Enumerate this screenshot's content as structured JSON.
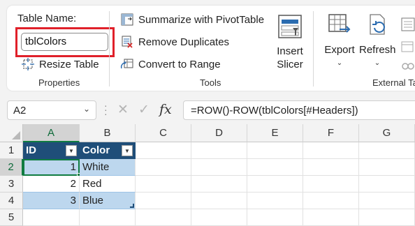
{
  "ribbon": {
    "properties": {
      "table_name_label": "Table Name:",
      "table_name_value": "tblColors",
      "resize_label": "Resize Table",
      "group_label": "Properties"
    },
    "tools": {
      "pivot_label": "Summarize with PivotTable",
      "dupes_label": "Remove Duplicates",
      "convert_label": "Convert to Range",
      "slicer_line1": "Insert",
      "slicer_line2": "Slicer",
      "group_label": "Tools"
    },
    "external": {
      "export_label": "Export",
      "refresh_label": "Refresh",
      "group_label": "External Ta"
    }
  },
  "formula_bar": {
    "name_box": "A2",
    "formula": "=ROW()-ROW(tblColors[#Headers])",
    "fx_label": "fx"
  },
  "grid": {
    "columns": [
      "A",
      "B",
      "C",
      "D",
      "E",
      "F",
      "G"
    ],
    "rows": [
      "1",
      "2",
      "3",
      "4",
      "5"
    ],
    "table": {
      "headers": [
        "ID",
        "Color"
      ],
      "rows": [
        [
          "1",
          "White"
        ],
        [
          "2",
          "Red"
        ],
        [
          "3",
          "Blue"
        ]
      ]
    },
    "active_cell": "A2"
  },
  "colors": {
    "table_header": "#1f4e79",
    "band": "#bdd7ee",
    "selection": "#107c41",
    "highlight_box": "#e0202a"
  }
}
